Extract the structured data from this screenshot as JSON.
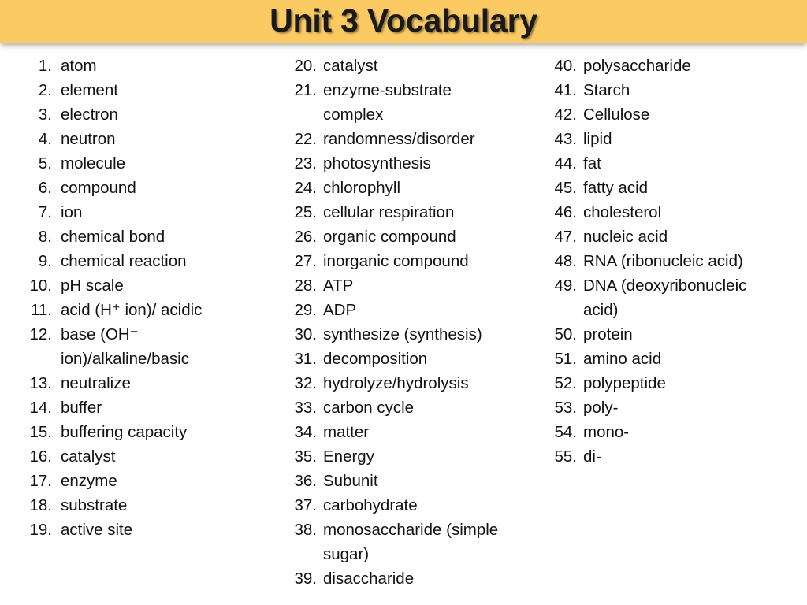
{
  "slide": {
    "title": "Unit 3 Vocabulary",
    "background_color": "#ffffff",
    "banner_color": "#fcca63",
    "text_color": "#111111"
  },
  "columns": [
    {
      "name": "column-1",
      "items": [
        {
          "number": "1.",
          "text": "atom"
        },
        {
          "number": "2.",
          "text": "element"
        },
        {
          "number": "3.",
          "text": "electron"
        },
        {
          "number": "4.",
          "text": "neutron"
        },
        {
          "number": "5.",
          "text": "molecule"
        },
        {
          "number": "6.",
          "text": "compound"
        },
        {
          "number": "7.",
          "text": "ion"
        },
        {
          "number": "8.",
          "text": "chemical bond"
        },
        {
          "number": "9.",
          "text": "chemical reaction"
        },
        {
          "number": "10.",
          "text": "pH scale"
        },
        {
          "number": "11.",
          "text": "acid (H⁺ ion)/ acidic"
        },
        {
          "number": "12.",
          "text": "base (OH⁻\nion)/alkaline/basic"
        },
        {
          "number": "13.",
          "text": "neutralize"
        },
        {
          "number": "14.",
          "text": "buffer"
        },
        {
          "number": "15.",
          "text": "buffering capacity"
        },
        {
          "number": "16.",
          "text": "catalyst"
        },
        {
          "number": "17.",
          "text": "enzyme"
        },
        {
          "number": "18.",
          "text": "substrate"
        },
        {
          "number": "19.",
          "text": "active site"
        }
      ]
    },
    {
      "name": "column-2",
      "items": [
        {
          "number": "20.",
          "text": "catalyst"
        },
        {
          "number": "21.",
          "text": "enzyme-substrate\ncomplex"
        },
        {
          "number": "22.",
          "text": "randomness/disorder"
        },
        {
          "number": "23.",
          "text": "photosynthesis"
        },
        {
          "number": "24.",
          "text": "chlorophyll"
        },
        {
          "number": "25.",
          "text": "cellular respiration"
        },
        {
          "number": "26.",
          "text": "organic compound"
        },
        {
          "number": "27.",
          "text": "inorganic compound"
        },
        {
          "number": "28.",
          "text": "ATP"
        },
        {
          "number": "29.",
          "text": "ADP"
        },
        {
          "number": "30.",
          "text": "synthesize (synthesis)"
        },
        {
          "number": "31.",
          "text": "decomposition"
        },
        {
          "number": "32.",
          "text": "hydrolyze/hydrolysis"
        },
        {
          "number": "33.",
          "text": "carbon cycle"
        },
        {
          "number": "34.",
          "text": "matter"
        },
        {
          "number": "35.",
          "text": "Energy"
        },
        {
          "number": "36.",
          "text": "Subunit"
        },
        {
          "number": "37.",
          "text": "carbohydrate"
        },
        {
          "number": "38.",
          "text": "monosaccharide (simple\nsugar)"
        },
        {
          "number": "39.",
          "text": "disaccharide"
        }
      ]
    },
    {
      "name": "column-3",
      "items": [
        {
          "number": "40.",
          "text": "polysaccharide"
        },
        {
          "number": "41.",
          "text": "Starch"
        },
        {
          "number": "42.",
          "text": "Cellulose"
        },
        {
          "number": "43.",
          "text": "lipid"
        },
        {
          "number": "44.",
          "text": "fat"
        },
        {
          "number": "45.",
          "text": "fatty acid"
        },
        {
          "number": "46.",
          "text": "cholesterol"
        },
        {
          "number": "47.",
          "text": "nucleic acid"
        },
        {
          "number": "48.",
          "text": "RNA (ribonucleic acid)"
        },
        {
          "number": "49.",
          "text": "DNA (deoxyribonucleic\nacid)"
        },
        {
          "number": "50.",
          "text": "protein"
        },
        {
          "number": "51.",
          "text": "amino acid"
        },
        {
          "number": "52.",
          "text": "polypeptide"
        },
        {
          "number": "53.",
          "text": "poly-"
        },
        {
          "number": "54.",
          "text": "mono-"
        },
        {
          "number": "55.",
          "text": "di-"
        }
      ]
    }
  ]
}
